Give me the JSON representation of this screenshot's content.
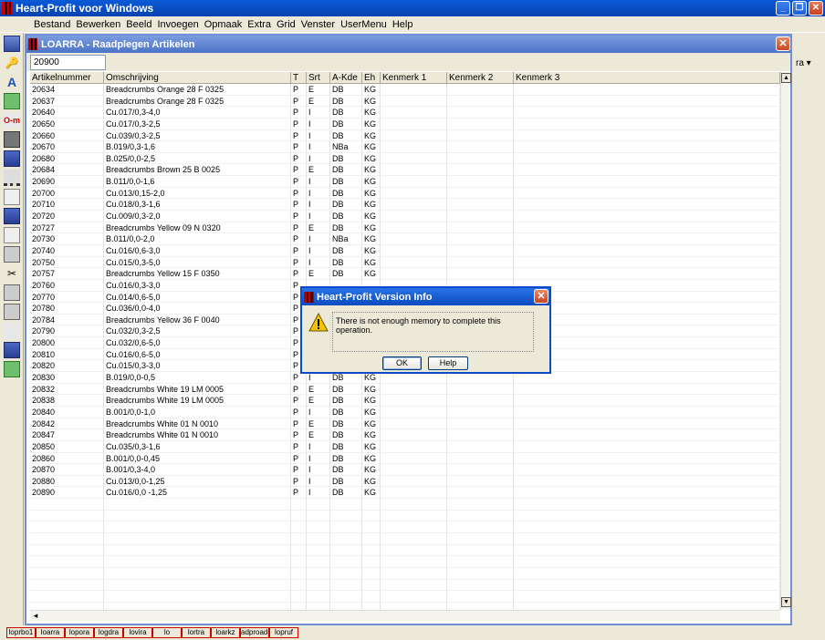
{
  "app": {
    "title": "Heart-Profit voor Windows"
  },
  "menu": [
    "Bestand",
    "Bewerken",
    "Beeld",
    "Invoegen",
    "Opmaak",
    "Extra",
    "Grid",
    "Venster",
    "UserMenu",
    "Help"
  ],
  "right_fragment": "ra ▾",
  "child": {
    "title": "LOARRA - Raadplegen Artikelen",
    "search_value": "20900"
  },
  "grid": {
    "columns": [
      "Artikelnummer",
      "Omschrijving",
      "T",
      "Srt",
      "A-Kde",
      "Eh",
      "Kenmerk 1",
      "Kenmerk 2",
      "Kenmerk 3"
    ],
    "rows": [
      [
        "20634",
        "Breadcrumbs Orange 28 F 0325",
        "P",
        "E",
        "DB",
        "KG"
      ],
      [
        "20637",
        "Breadcrumbs Orange 28 F 0325",
        "P",
        "E",
        "DB",
        "KG"
      ],
      [
        "20640",
        "Cu.017/0,3-4,0",
        "P",
        "I",
        "DB",
        "KG"
      ],
      [
        "20650",
        "Cu.017/0,3-2,5",
        "P",
        "I",
        "DB",
        "KG"
      ],
      [
        "20660",
        "Cu.039/0,3-2,5",
        "P",
        "I",
        "DB",
        "KG"
      ],
      [
        "20670",
        "B.019/0,3-1,6",
        "P",
        "I",
        "NBa",
        "KG"
      ],
      [
        "20680",
        "B.025/0,0-2,5",
        "P",
        "I",
        "DB",
        "KG"
      ],
      [
        "20684",
        "Breadcrumbs Brown 25 B 0025",
        "P",
        "E",
        "DB",
        "KG"
      ],
      [
        "20690",
        "B.011/0,0-1,6",
        "P",
        "I",
        "DB",
        "KG"
      ],
      [
        "20700",
        "Cu.013/0,15-2,0",
        "P",
        "I",
        "DB",
        "KG"
      ],
      [
        "20710",
        "Cu.018/0,3-1,6",
        "P",
        "I",
        "DB",
        "KG"
      ],
      [
        "20720",
        "Cu.009/0,3-2,0",
        "P",
        "I",
        "DB",
        "KG"
      ],
      [
        "20727",
        "Breadcrumbs Yellow 09 N 0320",
        "P",
        "E",
        "DB",
        "KG"
      ],
      [
        "20730",
        "B.011/0,0-2,0",
        "P",
        "I",
        "NBa",
        "KG"
      ],
      [
        "20740",
        "Cu.016/0,6-3,0",
        "P",
        "I",
        "DB",
        "KG"
      ],
      [
        "20750",
        "Cu.015/0,3-5,0",
        "P",
        "I",
        "DB",
        "KG"
      ],
      [
        "20757",
        "Breadcrumbs Yellow 15 F 0350",
        "P",
        "E",
        "DB",
        "KG"
      ],
      [
        "20760",
        "Cu.016/0,3-3,0",
        "P",
        "",
        "",
        ""
      ],
      [
        "20770",
        "Cu.014/0,6-5,0",
        "P",
        "",
        "",
        ""
      ],
      [
        "20780",
        "Cu.036/0,0-4,0",
        "P",
        "",
        "",
        ""
      ],
      [
        "20784",
        "Breadcrumbs Yellow 36 F 0040",
        "P",
        "",
        "",
        ""
      ],
      [
        "20790",
        "Cu.032/0,3-2,5",
        "P",
        "",
        "",
        ""
      ],
      [
        "20800",
        "Cu.032/0,6-5,0",
        "P",
        "",
        "",
        ""
      ],
      [
        "20810",
        "Cu.016/0,6-5,0",
        "P",
        "",
        "",
        ""
      ],
      [
        "20820",
        "Cu.015/0,3-3,0",
        "P",
        "",
        "",
        ""
      ],
      [
        "20830",
        "B.019/0,0-0,5",
        "P",
        "I",
        "DB",
        "KG"
      ],
      [
        "20832",
        "Breadcrumbs White 19 LM 0005",
        "P",
        "E",
        "DB",
        "KG"
      ],
      [
        "20838",
        "Breadcrumbs White 19 LM 0005",
        "P",
        "E",
        "DB",
        "KG"
      ],
      [
        "20840",
        "B.001/0,0-1,0",
        "P",
        "I",
        "DB",
        "KG"
      ],
      [
        "20842",
        "Breadcrumbs White 01 N 0010",
        "P",
        "E",
        "DB",
        "KG"
      ],
      [
        "20847",
        "Breadcrumbs White 01 N 0010",
        "P",
        "E",
        "DB",
        "KG"
      ],
      [
        "20850",
        "Cu.035/0,3-1,6",
        "P",
        "I",
        "DB",
        "KG"
      ],
      [
        "20860",
        "B.001/0,0-0,45",
        "P",
        "I",
        "DB",
        "KG"
      ],
      [
        "20870",
        "B.001/0,3-4,0",
        "P",
        "I",
        "DB",
        "KG"
      ],
      [
        "20880",
        "Cu.013/0,0-1,25",
        "P",
        "I",
        "DB",
        "KG"
      ],
      [
        "20890",
        "Cu.016/0,0 -1,25",
        "P",
        "I",
        "DB",
        "KG"
      ]
    ],
    "empty_rows": 10
  },
  "dialog": {
    "title": "Heart-Profit Version Info",
    "message": "There is not enough memory to complete this operation.",
    "ok_label": "OK",
    "help_label": "Help"
  },
  "tasks": [
    "loprbo1",
    "loarra",
    "lopora",
    "logdra",
    "lovira",
    "lo",
    "lortra",
    "loarkz",
    "adproade",
    "lopruf"
  ],
  "colors": {
    "title_blue": "#0a5ad8",
    "child_title": "#5a7ecb",
    "warning": "#f3c500",
    "task_border": "#c00"
  }
}
